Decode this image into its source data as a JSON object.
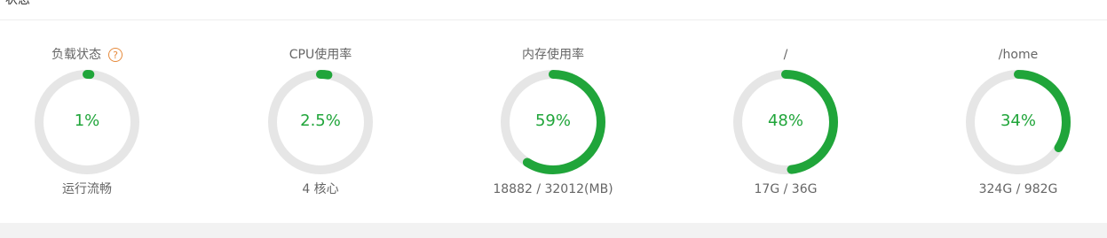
{
  "panel": {
    "title": "状态"
  },
  "gauges": [
    {
      "label": "负载状态",
      "help_icon": "question-circle-icon",
      "help_glyph": "?",
      "value": "1%",
      "percent": 1,
      "sub": "运行流畅"
    },
    {
      "label": "CPU使用率",
      "value": "2.5%",
      "percent": 2.5,
      "sub": "4 核心"
    },
    {
      "label": "内存使用率",
      "value": "59%",
      "percent": 59,
      "sub": "18882 / 32012(MB)"
    },
    {
      "label": "/",
      "value": "48%",
      "percent": 48,
      "sub": "17G / 36G"
    },
    {
      "label": "/home",
      "value": "34%",
      "percent": 34,
      "sub": "324G / 982G"
    }
  ],
  "colors": {
    "accent": "#20a53a",
    "track": "#e6e6e6",
    "help": "#e68a3c"
  }
}
